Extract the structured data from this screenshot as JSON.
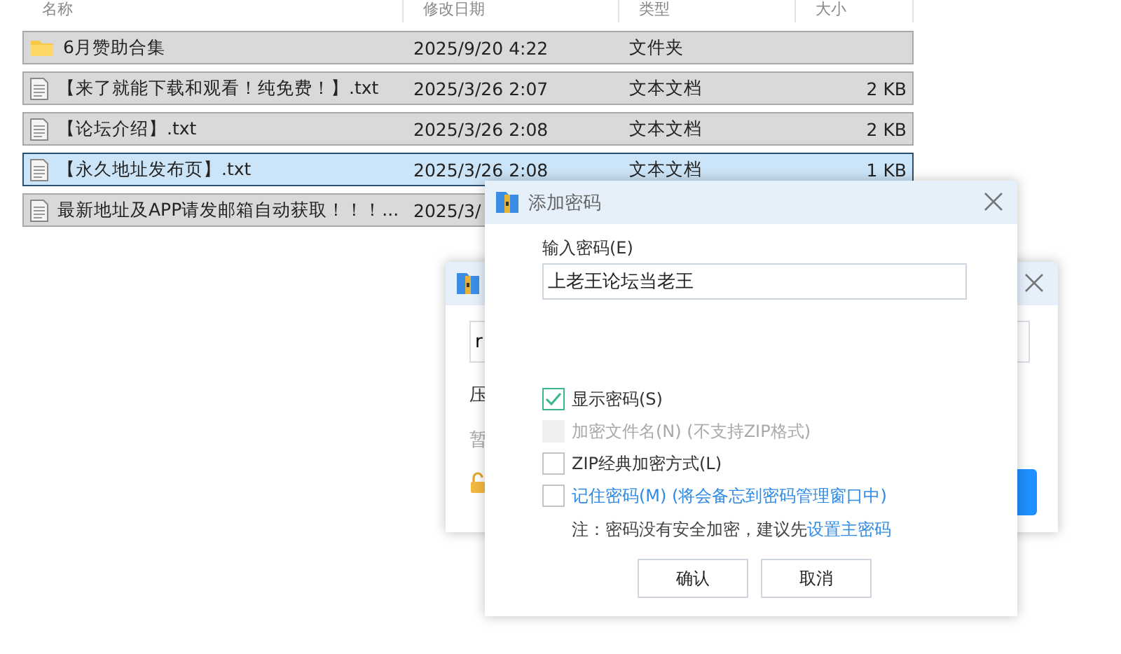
{
  "file_list": {
    "columns": [
      "名称",
      "修改日期",
      "类型",
      "大小"
    ],
    "rows": [
      {
        "kind": "folder",
        "name": "6月赞助合集",
        "date": "2025/9/20 4:22",
        "type": "文件夹",
        "selected": false
      },
      {
        "kind": "text",
        "name": "【来了就能下载和观看！纯免费！】.txt",
        "date": "2025/3/26 2:07",
        "type": "文本文档",
        "size": "2 KB",
        "selected": false
      },
      {
        "kind": "text",
        "name": "【论坛介绍】.txt",
        "date": "2025/3/26 2:08",
        "type": "文本文档",
        "size": "2 KB",
        "selected": false
      },
      {
        "kind": "text",
        "name": "【永久地址发布页】.txt",
        "date": "2025/3/26 2:08",
        "type": "文本文档",
        "size": "1 KB",
        "selected": true
      },
      {
        "kind": "text",
        "name": "最新地址及APP请发邮箱自动获取！！！...",
        "date": "2025/3/",
        "selected": false
      }
    ]
  },
  "background_dialog": {
    "field_value": "r",
    "lines": [
      "压",
      "暂"
    ]
  },
  "dialog": {
    "title": "添加密码",
    "password_label": "输入密码(E)",
    "password_value": "上老王论坛当老王",
    "options": [
      {
        "label": "显示密码(S)",
        "checked": true,
        "disabled": false,
        "link": false
      },
      {
        "label": "加密文件名(N) (不支持ZIP格式)",
        "checked": false,
        "disabled": true,
        "link": false
      },
      {
        "label": "ZIP经典加密方式(L)",
        "checked": false,
        "disabled": false,
        "link": false
      },
      {
        "label": "记住密码(M) (将会备忘到密码管理窗口中)",
        "checked": false,
        "disabled": false,
        "link": true
      }
    ],
    "note": "注：密码没有安全加密，建议先",
    "note_link": "设置主密码",
    "buttons": [
      "确认",
      "取消"
    ]
  }
}
